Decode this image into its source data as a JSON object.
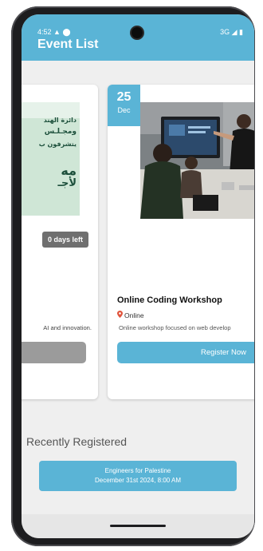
{
  "status_bar": {
    "time": "4:52",
    "left_icons": "▲ ⬤",
    "network": "3G",
    "right_icons": "◢ ▮"
  },
  "app_bar": {
    "title": "Event List"
  },
  "events": [
    {
      "poster_lines": [
        "دائرة الهند",
        "ومجـلـس",
        "يتشرفون ب",
        "مه",
        "لأجـ"
      ],
      "days_left": "0 days left",
      "description": "AI and innovation."
    },
    {
      "date_day": "25",
      "date_month": "Dec",
      "title": "Online Coding Workshop",
      "location": "Online",
      "description": "Online workshop focused on web develop",
      "register_label": "Register Now"
    }
  ],
  "recently_registered": {
    "heading": "Recently Registered",
    "items": [
      {
        "name": "Engineers for Palestine",
        "date": "December 31st 2024, 8:00 AM"
      }
    ]
  },
  "colors": {
    "accent": "#5ab4d6",
    "disabled": "#9b9b9b",
    "badge": "#6f6f6f",
    "background": "#efefef"
  }
}
